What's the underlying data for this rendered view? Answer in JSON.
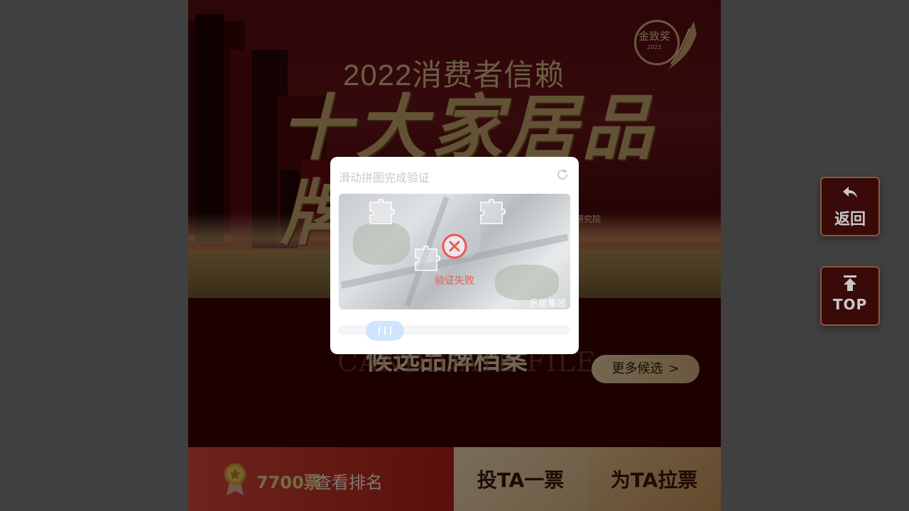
{
  "banner": {
    "title_year": "2022消费者信赖",
    "title_main": "十大家居品牌",
    "badge_title": "金致奖",
    "badge_year": "2022",
    "org_partial": "研究院"
  },
  "candidates": {
    "title_cn": "候选品牌档案",
    "title_en": "CANDIDATE FILE",
    "more_label": "更多候选",
    "more_arrow": ">"
  },
  "bottom_bar": {
    "votes_count": "7700票",
    "rank_label": "查看排名",
    "vote_label": "投TA一票",
    "pull_label": "为TA拉票"
  },
  "side_buttons": {
    "back_label": "返回",
    "top_label": "TOP"
  },
  "captcha": {
    "heading": "滑动拼图完成验证",
    "error_text": "验证失败",
    "watermark": "乐居集团"
  },
  "icons": {
    "back": "back-arrow-icon",
    "top": "arrow-to-top-icon",
    "refresh": "refresh-icon",
    "error": "error-x-icon",
    "medal": "medal-icon"
  },
  "colors": {
    "overlay": "#808080",
    "error": "#f25555",
    "slider_knob": "#d0e4ff",
    "gold": "#c7a46a",
    "vote_red": "#c0281e"
  }
}
